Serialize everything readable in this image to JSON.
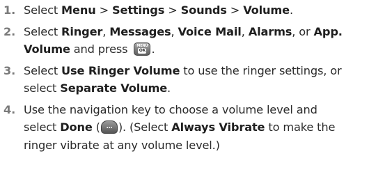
{
  "steps": [
    {
      "number": "1.",
      "parts": [
        "Select ",
        "Menu",
        " > ",
        "Settings",
        " > ",
        "Sounds",
        " > ",
        "Volume",
        "."
      ]
    },
    {
      "number": "2.",
      "parts": [
        "Select ",
        "Ringer",
        ", ",
        "Messages",
        ", ",
        "Voice Mail",
        ", ",
        "Alarms",
        ", or ",
        "App.",
        " ",
        "Volume",
        " and press ",
        "."
      ],
      "key": {
        "top": "MENU",
        "label": "OK",
        "icon": "menu-ok-key-icon"
      }
    },
    {
      "number": "3.",
      "parts": [
        "Select ",
        "Use Ringer Volume",
        " to use the ringer settings, or",
        "select ",
        "Separate Volume",
        "."
      ]
    },
    {
      "number": "4.",
      "parts": [
        "Use the navigation key to choose a volume level and",
        "select ",
        "Done",
        " (",
        "). (Select ",
        "Always Vibrate",
        " to make the",
        "ringer vibrate at any volume level.)"
      ],
      "key": {
        "label": "...",
        "icon": "softkey-icon"
      }
    }
  ]
}
